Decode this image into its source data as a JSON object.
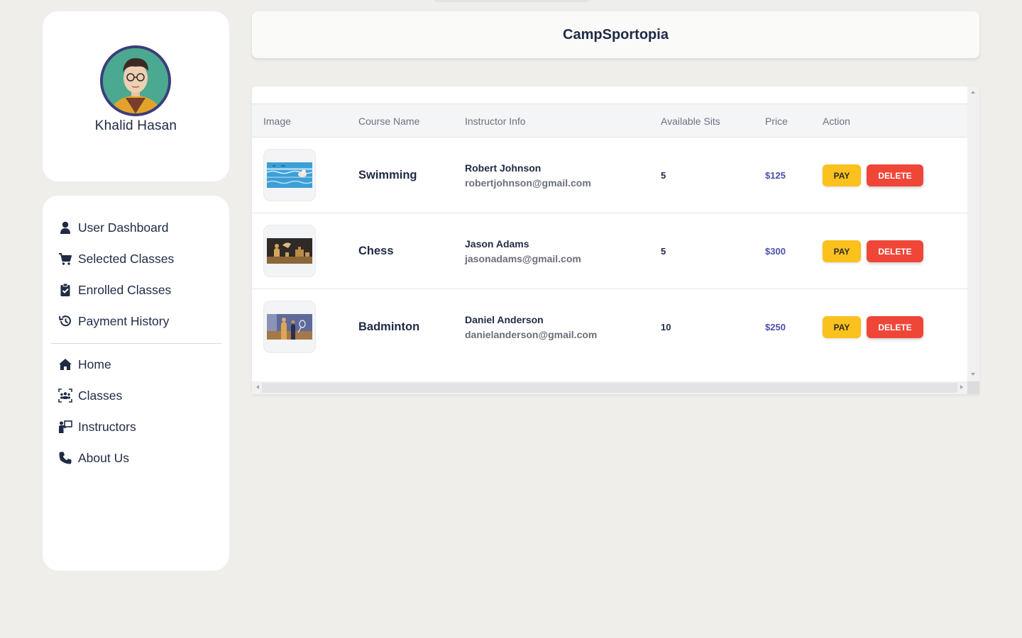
{
  "app": {
    "title": "CampSportopia"
  },
  "user": {
    "name": "Khalid Hasan"
  },
  "nav": {
    "dashboard_items": [
      {
        "label": "User Dashboard",
        "icon": "user-icon"
      },
      {
        "label": "Selected Classes",
        "icon": "cart-icon"
      },
      {
        "label": "Enrolled Classes",
        "icon": "clipboard-check-icon"
      },
      {
        "label": "Payment History",
        "icon": "history-icon"
      }
    ],
    "site_items": [
      {
        "label": "Home",
        "icon": "home-icon"
      },
      {
        "label": "Classes",
        "icon": "group-icon"
      },
      {
        "label": "Instructors",
        "icon": "instructor-icon"
      },
      {
        "label": "About Us",
        "icon": "phone-icon"
      }
    ]
  },
  "table": {
    "headers": [
      "Image",
      "Course Name",
      "Instructor Info",
      "Available Sits",
      "Price",
      "Action"
    ],
    "rows": [
      {
        "course": "Swimming",
        "instructor": "Robert Johnson",
        "email": "robertjohnson@gmail.com",
        "sits": "5",
        "price": "$125",
        "image": "swimming-image"
      },
      {
        "course": "Chess",
        "instructor": "Jason Adams",
        "email": "jasonadams@gmail.com",
        "sits": "5",
        "price": "$300",
        "image": "chess-image"
      },
      {
        "course": "Badminton",
        "instructor": "Daniel Anderson",
        "email": "danielanderson@gmail.com",
        "sits": "10",
        "price": "$250",
        "image": "badminton-image"
      }
    ],
    "pay_label": "PAY",
    "delete_label": "DELETE"
  },
  "colors": {
    "page_bg": "#efeeeb",
    "pay": "#fbc11c",
    "delete": "#ef4638",
    "price": "#4b4faa",
    "text": "#1f2a44"
  }
}
